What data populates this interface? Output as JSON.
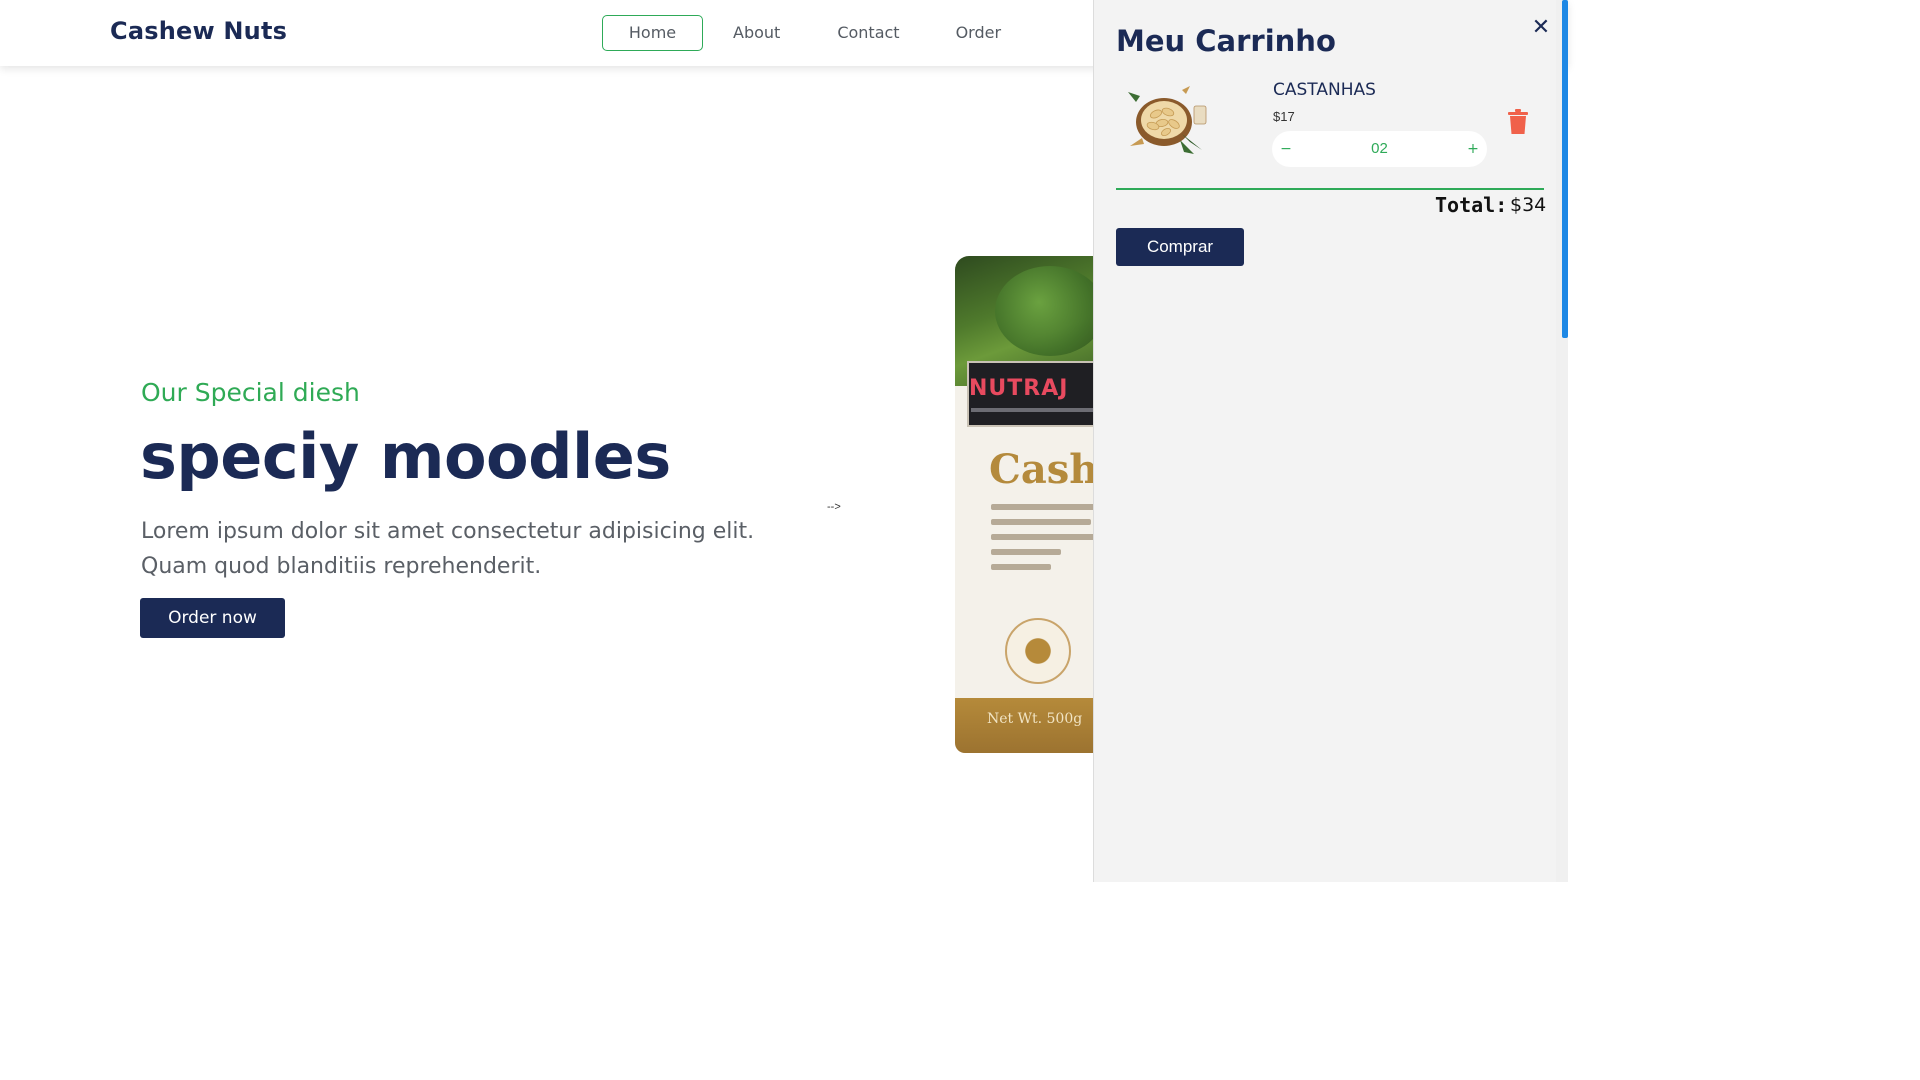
{
  "header": {
    "brand": "Cashew Nuts",
    "nav": [
      {
        "label": "Home",
        "active": true
      },
      {
        "label": "About",
        "active": false
      },
      {
        "label": "Contact",
        "active": false
      },
      {
        "label": "Order",
        "active": false
      }
    ]
  },
  "hero": {
    "subtitle": "Our Special diesh",
    "title": "speciy moodles",
    "text_line1": "Lorem ipsum dolor sit amet consectetur adipisicing elit.",
    "text_line2": "Quam quod blanditiis reprehenderit.",
    "button_label": "Order now",
    "stray_text": "-->"
  },
  "product_image": {
    "brand": "NUTRAJ",
    "name": "Cashe",
    "weight": "Net Wt. 500g"
  },
  "cart": {
    "title": "Meu Carrinho",
    "close_icon": "close-icon",
    "items": [
      {
        "name": "CASTANHAS",
        "price": "$17",
        "quantity": "02",
        "minus_label": "−",
        "plus_label": "+",
        "thumbnail": "cashew-bowl-image"
      }
    ],
    "total_label": "Total:",
    "total_value": "$34",
    "buy_label": "Comprar"
  },
  "colors": {
    "navy": "#1b2a55",
    "green": "#2eaa58",
    "trash": "#f0614a",
    "scrollbar": "#1e88e5"
  }
}
